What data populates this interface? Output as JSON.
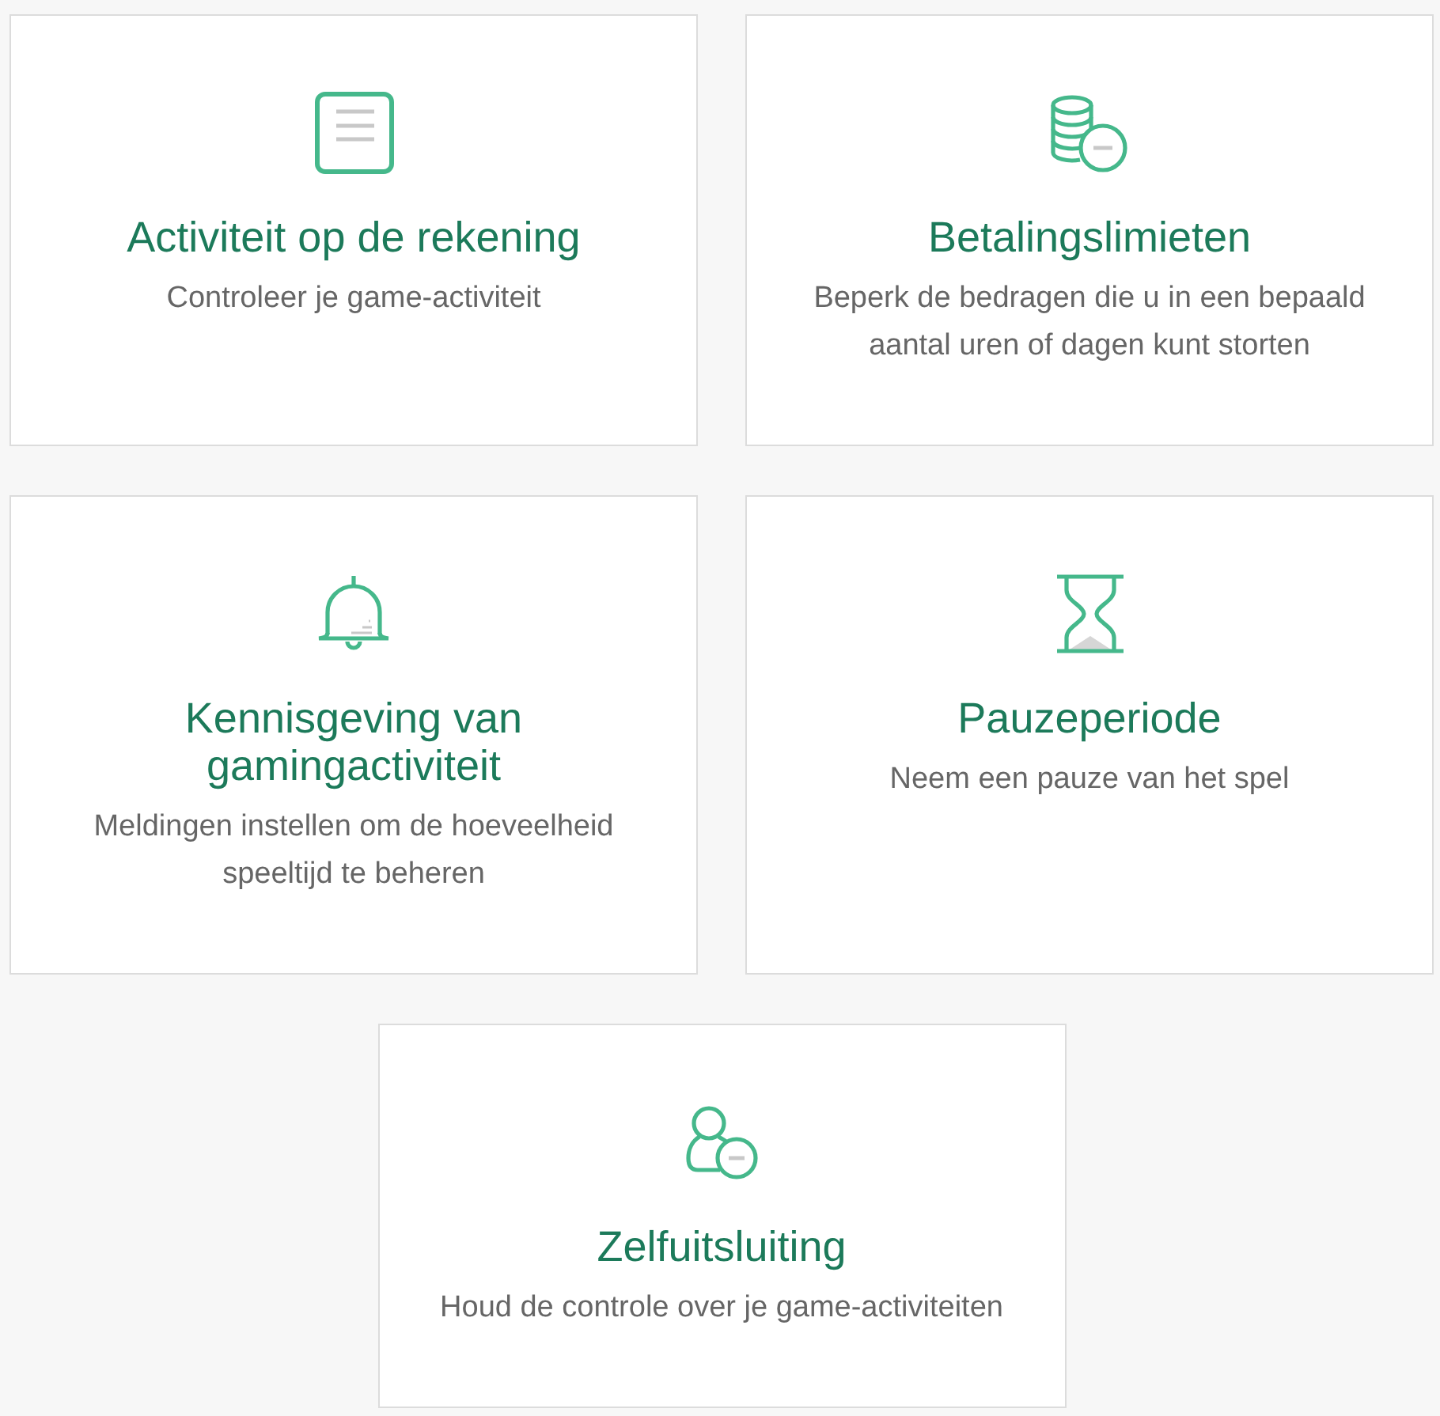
{
  "cards": [
    {
      "kind": "document",
      "title": "Activiteit op de rekening",
      "description": "Controleer je game-activiteit"
    },
    {
      "kind": "coins",
      "title": "Betalingslimieten",
      "description": "Beperk de bedragen die u in een bepaald aantal uren of dagen kunt storten"
    },
    {
      "kind": "bell",
      "title": "Kennisgeving van gamingactiviteit",
      "description": "Meldingen instellen om de hoeveelheid speeltijd te beheren"
    },
    {
      "kind": "hourglass",
      "title": "Pauzeperiode",
      "description": "Neem een pauze van het spel"
    },
    {
      "kind": "user",
      "title": "Zelfuitsluiting",
      "description": "Houd de controle over je game-activiteiten"
    }
  ]
}
